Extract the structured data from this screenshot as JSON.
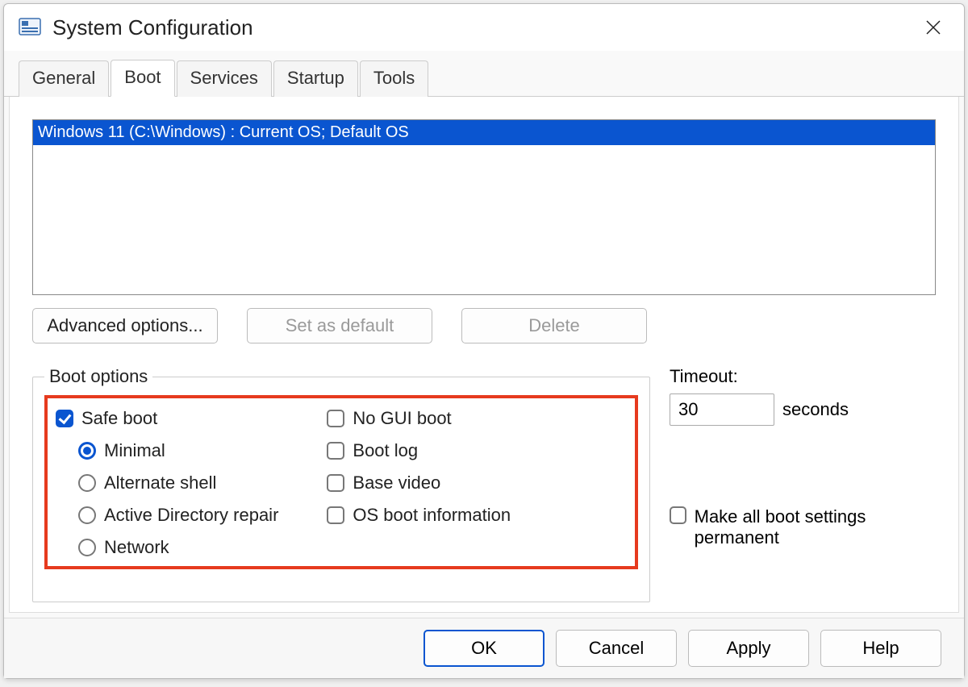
{
  "window": {
    "title": "System Configuration"
  },
  "tabs": {
    "general": "General",
    "boot": "Boot",
    "services": "Services",
    "startup": "Startup",
    "tools": "Tools",
    "active": "boot"
  },
  "oslist": {
    "entry": "Windows 11 (C:\\Windows) : Current OS; Default OS"
  },
  "buttons": {
    "advanced": "Advanced options...",
    "setdefault": "Set as default",
    "delete": "Delete"
  },
  "bootoptions": {
    "legend": "Boot options",
    "safeboot": {
      "label": "Safe boot",
      "checked": true
    },
    "radios": {
      "minimal": "Minimal",
      "altshell": "Alternate shell",
      "adrepair": "Active Directory repair",
      "network": "Network",
      "selected": "minimal"
    },
    "noguiboot": {
      "label": "No GUI boot",
      "checked": false
    },
    "bootlog": {
      "label": "Boot log",
      "checked": false
    },
    "basevideo": {
      "label": "Base video",
      "checked": false
    },
    "osbootinfo": {
      "label": "OS boot information",
      "checked": false
    }
  },
  "timeout": {
    "label": "Timeout:",
    "value": "30",
    "unit": "seconds"
  },
  "permanent": {
    "label": "Make all boot settings permanent",
    "checked": false
  },
  "footer": {
    "ok": "OK",
    "cancel": "Cancel",
    "apply": "Apply",
    "help": "Help"
  }
}
